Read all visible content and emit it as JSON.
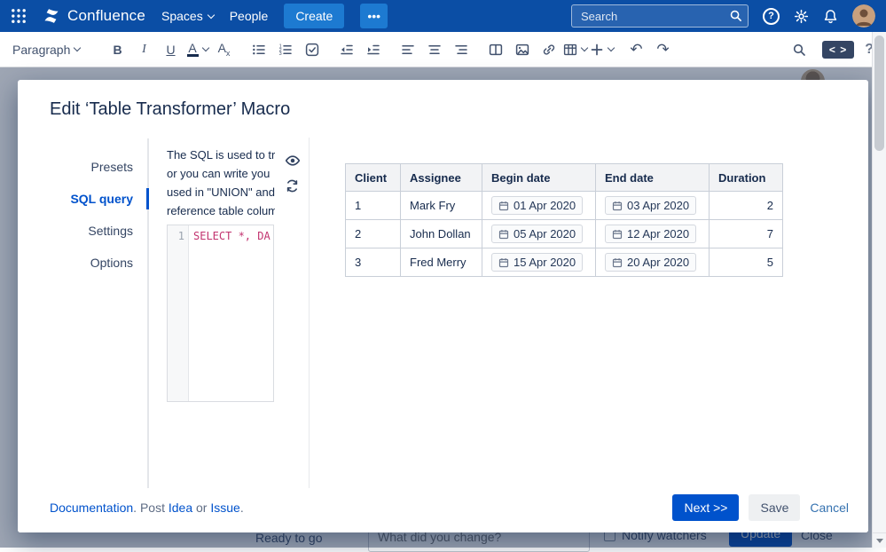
{
  "colors": {
    "nav-bg": "#0b4ea5",
    "create-btn": "#1d7ad1",
    "accent": "#0052cc",
    "link": "#0052cc"
  },
  "nav": {
    "brand": "Confluence",
    "spaces": "Spaces",
    "people": "People",
    "create": "Create",
    "more": "•••",
    "search_placeholder": "Search",
    "help": "?"
  },
  "toolbar": {
    "style": "Paragraph",
    "bold": "B",
    "italic": "I",
    "underline": "U",
    "color_letter": "A",
    "more_fmt": "A",
    "more_fmt_sub": "x",
    "undo_glyph": "↶",
    "redo_glyph": "↷",
    "source": "< >",
    "help": "?"
  },
  "modal": {
    "title": "Edit ‘Table Transformer’ Macro",
    "tabs": [
      {
        "label": "Presets"
      },
      {
        "label": "SQL query"
      },
      {
        "label": "Settings"
      },
      {
        "label": "Options"
      }
    ],
    "description_lines": [
      "The SQL is used to tr",
      "or you can write you",
      "used in \"UNION\" and",
      "reference table colum"
    ],
    "code": {
      "line_number": "1",
      "text": "SELECT *, DA"
    },
    "preview_table": {
      "headers": [
        "Client",
        "Assignee",
        "Begin date",
        "End date",
        "Duration"
      ],
      "rows": [
        {
          "client": "1",
          "assignee": "Mark Fry",
          "begin_date": "01 Apr 2020",
          "end_date": "03 Apr 2020",
          "duration": "2"
        },
        {
          "client": "2",
          "assignee": "John Dollan",
          "begin_date": "05 Apr 2020",
          "end_date": "12 Apr 2020",
          "duration": "7"
        },
        {
          "client": "3",
          "assignee": "Fred Merry",
          "begin_date": "15 Apr 2020",
          "end_date": "20 Apr 2020",
          "duration": "5"
        }
      ]
    },
    "footer": {
      "documentation": "Documentation",
      "sep1": ". Post ",
      "idea": "Idea",
      "sep2": " or ",
      "issue": "Issue",
      "sep3": ".",
      "next": "Next >>",
      "save": "Save",
      "cancel": "Cancel"
    }
  },
  "background_page": {
    "status": "Ready to go",
    "comment_placeholder": "What did you change?",
    "notify_watchers": "Notify watchers",
    "update": "Update",
    "close": "Close"
  }
}
